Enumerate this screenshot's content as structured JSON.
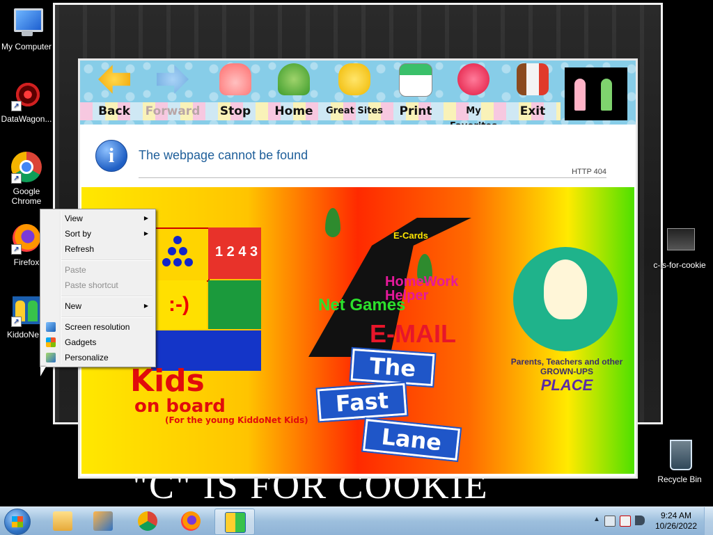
{
  "desktop": {
    "icons": [
      {
        "label": "My Computer"
      },
      {
        "label": "DataWagon..."
      },
      {
        "label": "Google Chrome"
      },
      {
        "label": "Firefox"
      },
      {
        "label": "KiddoNe..."
      },
      {
        "label": "c-is-for-cookie"
      },
      {
        "label": "Recycle Bin"
      }
    ],
    "background_text": "\"C\" IS FOR COOKIE"
  },
  "kiddonet": {
    "toolbar": [
      {
        "label": "Back",
        "icon": "back-arrow-icon",
        "enabled": true
      },
      {
        "label": "Forward",
        "icon": "forward-arrow-icon",
        "enabled": false
      },
      {
        "label": "Stop",
        "icon": "stop-hand-icon",
        "enabled": true
      },
      {
        "label": "Home",
        "icon": "home-turtle-icon",
        "enabled": true
      },
      {
        "label": "Great Sites",
        "icon": "thumbs-up-icon",
        "enabled": true
      },
      {
        "label": "Print",
        "icon": "print-icon",
        "enabled": true
      },
      {
        "label": "My Favorites",
        "icon": "heart-icon",
        "enabled": true
      },
      {
        "label": "Exit",
        "icon": "exit-door-icon",
        "enabled": true
      }
    ],
    "error": {
      "title": "The webpage cannot be found",
      "code": "HTTP 404"
    },
    "splash": {
      "ecards": "E-Cards",
      "homework": "HomeWork Helper",
      "netgames": "Net Games",
      "email": "E-MAIL",
      "sign_the": "The",
      "sign_fast": "Fast",
      "sign_lane": "Lane",
      "kids": "Kids",
      "onboard": "on board",
      "young": "(For the young KiddoNet Kids)",
      "parents": "Parents, Teachers and other GROWN-UPS",
      "place": "PLACE",
      "puzzle_face": ":-)",
      "puzzle_numbers": "1 2 4 3"
    }
  },
  "context_menu": {
    "items": [
      {
        "label": "View",
        "submenu": true,
        "enabled": true
      },
      {
        "label": "Sort by",
        "submenu": true,
        "enabled": true
      },
      {
        "label": "Refresh",
        "submenu": false,
        "enabled": true
      },
      {
        "label": "Paste",
        "submenu": false,
        "enabled": false
      },
      {
        "label": "Paste shortcut",
        "submenu": false,
        "enabled": false
      },
      {
        "label": "New",
        "submenu": true,
        "enabled": true
      },
      {
        "label": "Screen resolution",
        "submenu": false,
        "enabled": true,
        "icon": "screen-resolution-icon"
      },
      {
        "label": "Gadgets",
        "submenu": false,
        "enabled": true,
        "icon": "gadgets-icon"
      },
      {
        "label": "Personalize",
        "submenu": false,
        "enabled": true,
        "icon": "personalize-icon"
      }
    ]
  },
  "taskbar": {
    "time": "9:24 AM",
    "date": "10/26/2022",
    "pinned": [
      "explorer-icon",
      "media-player-icon",
      "chrome-icon",
      "firefox-icon",
      "kiddonet-icon"
    ]
  }
}
